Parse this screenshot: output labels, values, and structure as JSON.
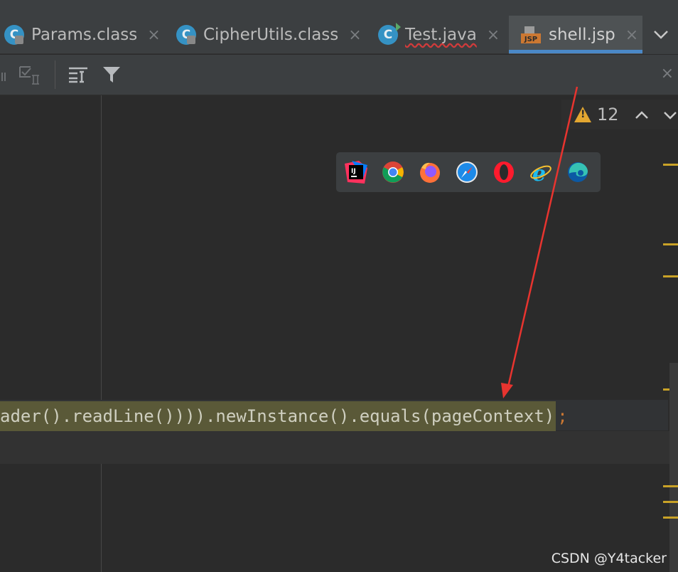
{
  "tabs": [
    {
      "label": "Params.class",
      "icon": "class-file-icon",
      "close": "×"
    },
    {
      "label": "CipherUtils.class",
      "icon": "class-file-icon",
      "close": "×"
    },
    {
      "label": "Test.java",
      "icon": "java-test-class-icon",
      "close": "×"
    },
    {
      "label": "shell.jsp",
      "icon": "jsp-file-icon",
      "close": "×",
      "active": true
    }
  ],
  "tab_overflow": "❯",
  "toolbar": {
    "close": "×"
  },
  "inspection": {
    "warning_count": "12",
    "up": "▲",
    "down": "▼"
  },
  "browsers": [
    "intellij-icon",
    "chrome-icon",
    "firefox-icon",
    "safari-icon",
    "opera-icon",
    "ie-icon",
    "edge-icon"
  ],
  "code": {
    "line": "ader().readLine()))).newInstance().equals(pageContext)",
    "terminator": ";"
  },
  "colors": {
    "warning": "#e3a731",
    "tab_underline": "#4a88c7",
    "annotation_arrow": "#e8342f",
    "match_highlight": "#5a5938"
  },
  "watermark": "CSDN @Y4tacker"
}
